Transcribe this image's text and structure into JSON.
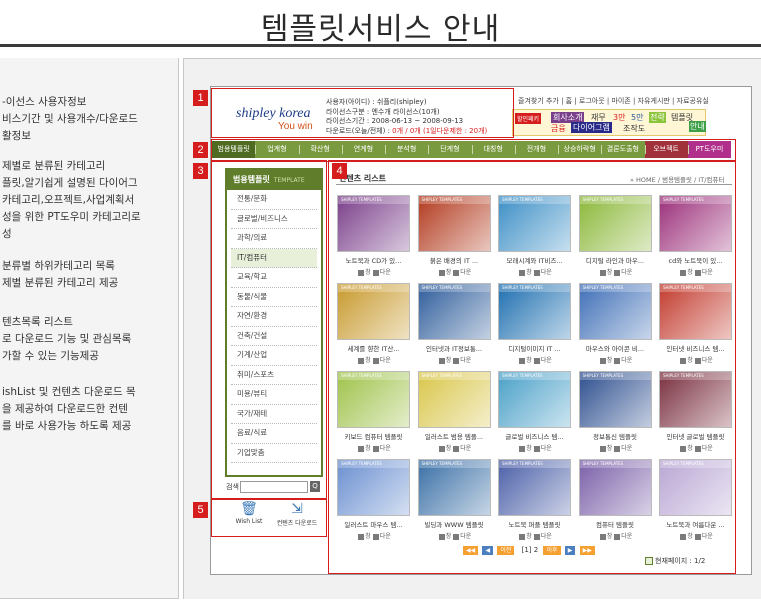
{
  "header": {
    "title": "템플릿서비스 안내"
  },
  "left_panel": {
    "block1": [
      "-이선스 사용자정보",
      "비스기간 및 사용개수/다운로드",
      "활정보"
    ],
    "block2": [
      "제별로 분류된 카테고리",
      "플릿,알기쉽게 설명된 다이어그",
      "카테고리,오프젝트,사업계획서",
      "성을 위한 PT도우미 카테고리로",
      "성"
    ],
    "block3": [
      "분류별 하위카테고리 목록",
      "제별 분류된 카테고리 제공"
    ],
    "block4": [
      "텐츠목록 리스트",
      "로 다운로드 기능 및 관심목록",
      "가할 수 있는 기능제공"
    ],
    "block5": [
      "ishList 및 컨텐츠 다운로드 목",
      "을 제공하여  다운로드한 컨텐",
      "를 바로 사용가능 하도록 제공"
    ]
  },
  "markers": [
    "1",
    "2",
    "3",
    "4",
    "5"
  ],
  "site": {
    "logo": "shipley korea",
    "logo_sub": "You win",
    "userinfo": {
      "line1": "사용자(아이디) : 쉬플리(shipley)",
      "line2": "라이선스구분 : 엔수개 라이선스(10개)",
      "line3": "라이선스기간 : 2008-06-13 ~ 2008-09-13",
      "line4_label": "다운로드(오늘/전체) : ",
      "line4_value": "0개 / 0개 (1일다운제한 : 20개)"
    },
    "topnav": "즐겨찾기 추가    |  홈 | 로그아웃 | 마이존 | 자유게시판 | 자료공유실",
    "banner": {
      "tag": "할인패키",
      "a": "회사소개",
      "b": "재무",
      "c": "3만",
      "d": "5만",
      "e": "전략",
      "f": "템플릿",
      "g": "안내",
      "h": "금융",
      "i": "다이어그램",
      "j": "조작도"
    },
    "categories": [
      "범용템플릿",
      "업계형",
      "확산형",
      "연계형",
      "분석형",
      "단계형",
      "대칭형",
      "전개형",
      "상승하락형",
      "결론도출형",
      "오브젝트",
      "PT도우미"
    ],
    "sidebar": {
      "title": "범용템플릿",
      "title_en": "TEMPLATE",
      "items": [
        "전통/문화",
        "글로벌/비즈니스",
        "과학/의료",
        "IT/컴퓨터",
        "교육/학교",
        "동물/식물",
        "자연/환경",
        "건축/건설",
        "기계/산업",
        "취미/스포츠",
        "미용/뷰티",
        "국가/재테",
        "음료/식료",
        "기업맞춤"
      ],
      "selected": "IT/컴퓨터",
      "search_label": "검색",
      "search_btn": "Q"
    },
    "wish": {
      "wish_label": "Wish List",
      "download_label": "컨텐츠 다운로드"
    },
    "content": {
      "title_prefix": "컨텐츠",
      "title_rest": " 리스트",
      "breadcrumb": "» HOME / 범용템플릿 / IT/컴퓨터",
      "action_view": "창",
      "action_down": "다운",
      "thumb_caption": "SHIPLEY TEMPLATES",
      "tiles": [
        {
          "caption": "노트북과 CD가 있...",
          "color": "#7a3f8a"
        },
        {
          "caption": "붉은 배경의 IT ...",
          "color": "#b23a1e"
        },
        {
          "caption": "모래시계와 IT비즈...",
          "color": "#3c8fc6"
        },
        {
          "caption": "디지털 라인과 마우...",
          "color": "#8cb83a"
        },
        {
          "caption": "cd와 노트북이 있...",
          "color": "#9b2f7a"
        },
        {
          "caption": "세계를 향한 IT산...",
          "color": "#c89a2e"
        },
        {
          "caption": "인터넷과 IT정보통...",
          "color": "#2f5d9b"
        },
        {
          "caption": "디지털이미지 IT ...",
          "color": "#1e6fb0"
        },
        {
          "caption": "마우스와 아이콘 비...",
          "color": "#3f6fb7"
        },
        {
          "caption": "인터넷 비즈니스 템...",
          "color": "#c23b2e"
        },
        {
          "caption": "키보드 컴퓨터 템플릿",
          "color": "#9fc24a"
        },
        {
          "caption": "일러스트 범용 템플...",
          "color": "#d9c64a"
        },
        {
          "caption": "글로벌 비즈니스 템...",
          "color": "#4aa0c8"
        },
        {
          "caption": "정보통신 템플릿",
          "color": "#2e4f8f"
        },
        {
          "caption": "인터넷 글로벌 템플릿",
          "color": "#7a2f3f"
        },
        {
          "caption": "일러스트 마우스 템...",
          "color": "#6a8fd0"
        },
        {
          "caption": "빌딩과 WWW 템플릿",
          "color": "#3a6fa6"
        },
        {
          "caption": "노트북 퍼플 템플릿",
          "color": "#4b5fa8"
        },
        {
          "caption": "컴퓨터 템플릿",
          "color": "#7a5fa8"
        },
        {
          "caption": "노트북과 여름다운 ...",
          "color": "#b9a6d4"
        }
      ]
    },
    "pager": {
      "first": "◀◀",
      "prev": "◀",
      "prev_label": "이전",
      "pages": "[1] 2",
      "next_label": "이후",
      "next": "▶",
      "last": "▶▶",
      "info": "현재페이지 : 1/2"
    }
  },
  "colors": {
    "accent_green": "#5f7d2a",
    "marker_red": "#d61d1d",
    "title_rule": "#3b3b3b"
  }
}
